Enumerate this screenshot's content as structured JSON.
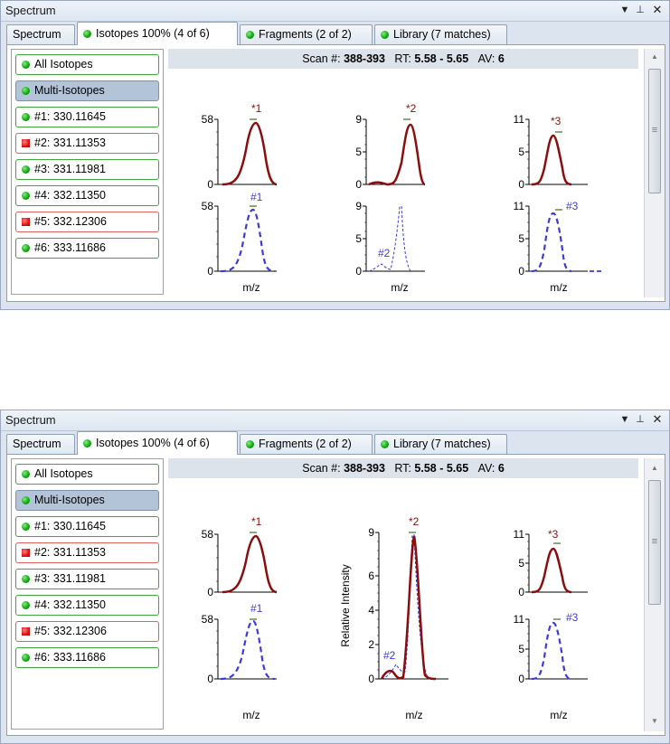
{
  "panels": [
    {
      "title": "Spectrum",
      "tabs": [
        "Spectrum",
        "Isotopes 100% (4 of 6)",
        "Fragments (2 of 2)",
        "Library (7 matches)"
      ],
      "items": [
        {
          "label": "All Isotopes",
          "status": "green"
        },
        {
          "label": "Multi-Isotopes",
          "status": "green",
          "selected": true
        },
        {
          "label": "#1: 330.11645",
          "status": "green"
        },
        {
          "label": "#2: 331.11353",
          "status": "red"
        },
        {
          "label": "#3: 331.11981",
          "status": "green"
        },
        {
          "label": "#4: 332.11350",
          "status": "green"
        },
        {
          "label": "#5: 332.12306",
          "status": "red"
        },
        {
          "label": "#6: 333.11686",
          "status": "green"
        }
      ],
      "header": {
        "scan_label": "Scan #:",
        "scan_value": "388-393",
        "rt_label": "RT:",
        "rt_value": "5.58 - 5.65",
        "av_label": "AV:",
        "av_value": "6"
      },
      "plots": {
        "xlabel": "m/z",
        "ylabel": "",
        "top": [
          {
            "label": "*1",
            "ymax_tick": "58",
            "ticks": [
              "58",
              "0"
            ]
          },
          {
            "label": "*2",
            "ymax_tick": "9",
            "ticks": [
              "9",
              "5",
              "0"
            ]
          },
          {
            "label": "*3",
            "ymax_tick": "11",
            "ticks": [
              "11",
              "5",
              "0"
            ]
          }
        ],
        "bottom": [
          {
            "label": "#1",
            "ticks": [
              "58",
              "0"
            ]
          },
          {
            "label": "#2",
            "ticks": [
              "9",
              "5",
              "0"
            ]
          },
          {
            "label": "#3",
            "ticks": [
              "11",
              "5",
              "0"
            ]
          }
        ]
      }
    },
    {
      "title": "Spectrum",
      "tabs": [
        "Spectrum",
        "Isotopes 100% (4 of 6)",
        "Fragments (2 of 2)",
        "Library (7 matches)"
      ],
      "items": [
        {
          "label": "All Isotopes",
          "status": "green"
        },
        {
          "label": "Multi-Isotopes",
          "status": "green",
          "selected": true
        },
        {
          "label": "#1: 330.11645",
          "status": "green"
        },
        {
          "label": "#2: 331.11353",
          "status": "red"
        },
        {
          "label": "#3: 331.11981",
          "status": "green"
        },
        {
          "label": "#4: 332.11350",
          "status": "green"
        },
        {
          "label": "#5: 332.12306",
          "status": "red"
        },
        {
          "label": "#6: 333.11686",
          "status": "green"
        }
      ],
      "header": {
        "scan_label": "Scan #:",
        "scan_value": "388-393",
        "rt_label": "RT:",
        "rt_value": "5.58 - 5.65",
        "av_label": "AV:",
        "av_value": "6"
      },
      "plots": {
        "xlabel": "m/z",
        "ylabel": "Relative Intensity",
        "top": [
          {
            "label": "*1",
            "ticks": [
              "58",
              "0"
            ]
          },
          {
            "label": "*2",
            "ticks": [
              "9",
              "6",
              "4",
              "2",
              "0"
            ]
          },
          {
            "label": "*3",
            "ticks": [
              "11",
              "5",
              "0"
            ]
          }
        ],
        "bottom": [
          {
            "label": "#1",
            "ticks": [
              "58",
              "0"
            ]
          },
          {
            "label": "#2",
            "ticks": []
          },
          {
            "label": "#3",
            "ticks": [
              "11",
              "5",
              "0"
            ]
          }
        ]
      }
    }
  ],
  "colors": {
    "observed": "#8b0e0e",
    "theoretical": "#3b3bdc",
    "accent_green": "#3fa83f",
    "accent_red": "#e06060"
  }
}
